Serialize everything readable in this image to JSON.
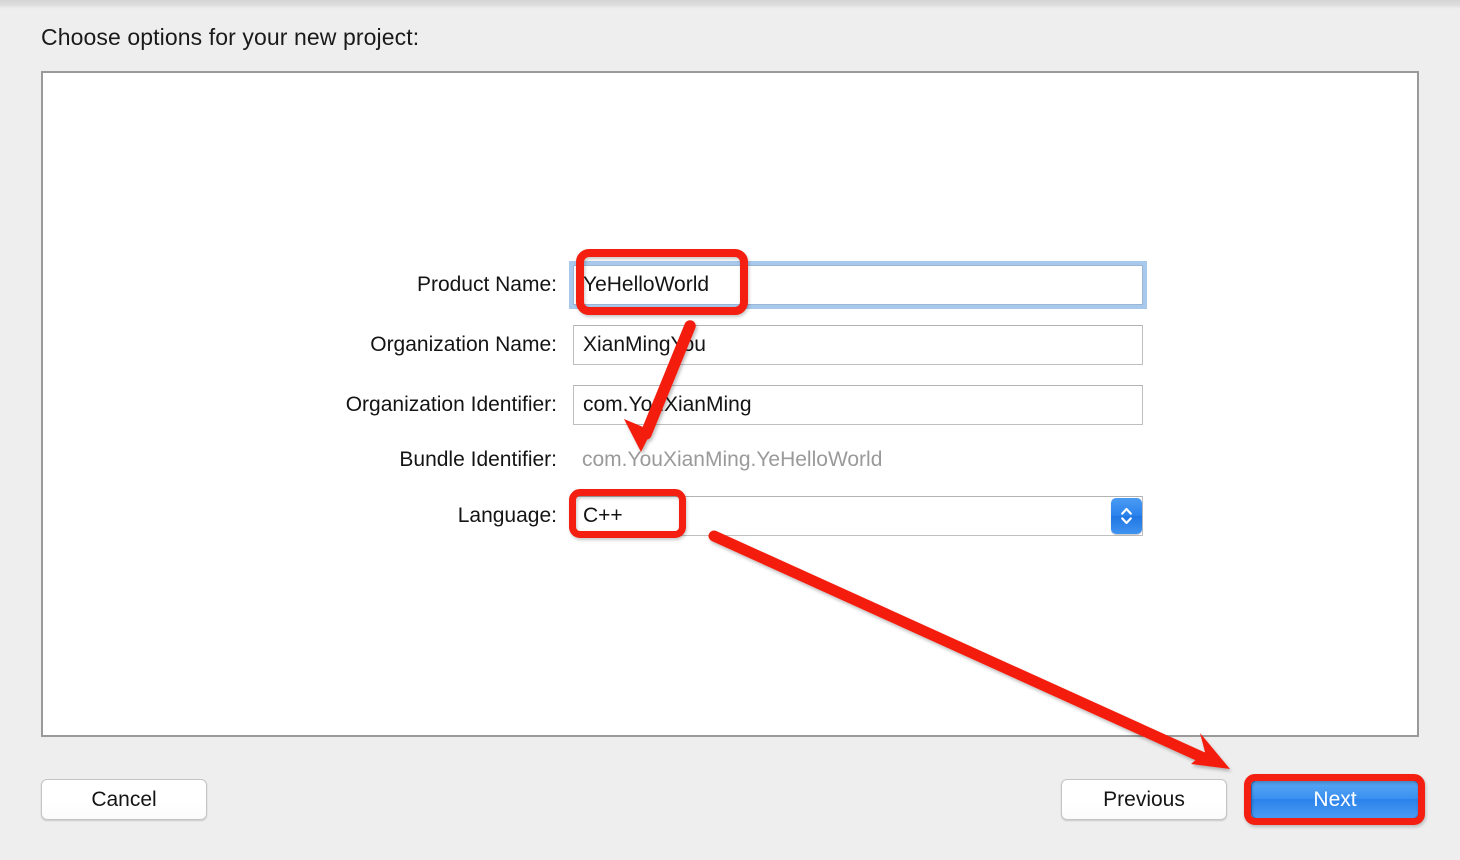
{
  "window": {
    "heading": "Choose options for your new project:"
  },
  "form": {
    "fields": [
      {
        "id": "product-name",
        "label": "Product Name:",
        "value": "YeHelloWorld",
        "type": "text",
        "focused": true
      },
      {
        "id": "organization-name",
        "label": "Organization Name:",
        "value": "XianMingYou",
        "type": "text",
        "focused": false
      },
      {
        "id": "organization-identifier",
        "label": "Organization Identifier:",
        "value": "com.YouXianMing",
        "type": "text",
        "focused": false
      },
      {
        "id": "bundle-identifier",
        "label": "Bundle Identifier:",
        "value": "com.YouXianMing.YeHelloWorld",
        "type": "static",
        "focused": false
      },
      {
        "id": "language",
        "label": "Language:",
        "value": "C++",
        "type": "popup",
        "focused": false,
        "stepper_icon": "chevron-up-down-icon"
      }
    ]
  },
  "buttons": {
    "cancel": "Cancel",
    "previous": "Previous",
    "next": "Next"
  },
  "annotations": {
    "highlight_color": "#f41f10",
    "rectangles": [
      {
        "name": "product-name-highlight",
        "target": "Product Name value YeHelloWorld"
      },
      {
        "name": "language-highlight",
        "target": "Language value C++"
      },
      {
        "name": "next-button-highlight",
        "target": "Next button"
      }
    ],
    "arrows": [
      {
        "name": "arrow-to-bundle-identifier",
        "from": "Organization Name / Organization Identifier area",
        "to": "Bundle Identifier value"
      },
      {
        "name": "arrow-to-next-button",
        "from": "Language popup",
        "to": "Next button"
      }
    ]
  },
  "colors": {
    "background": "#efeeee",
    "panel": "#ffffff",
    "panel_border": "#9a9a9a",
    "accent_blue": "#2b82ea",
    "focus_ring": "#a8c8ec",
    "annotation_red": "#f41f10",
    "disabled_text": "#9a9a9a"
  }
}
